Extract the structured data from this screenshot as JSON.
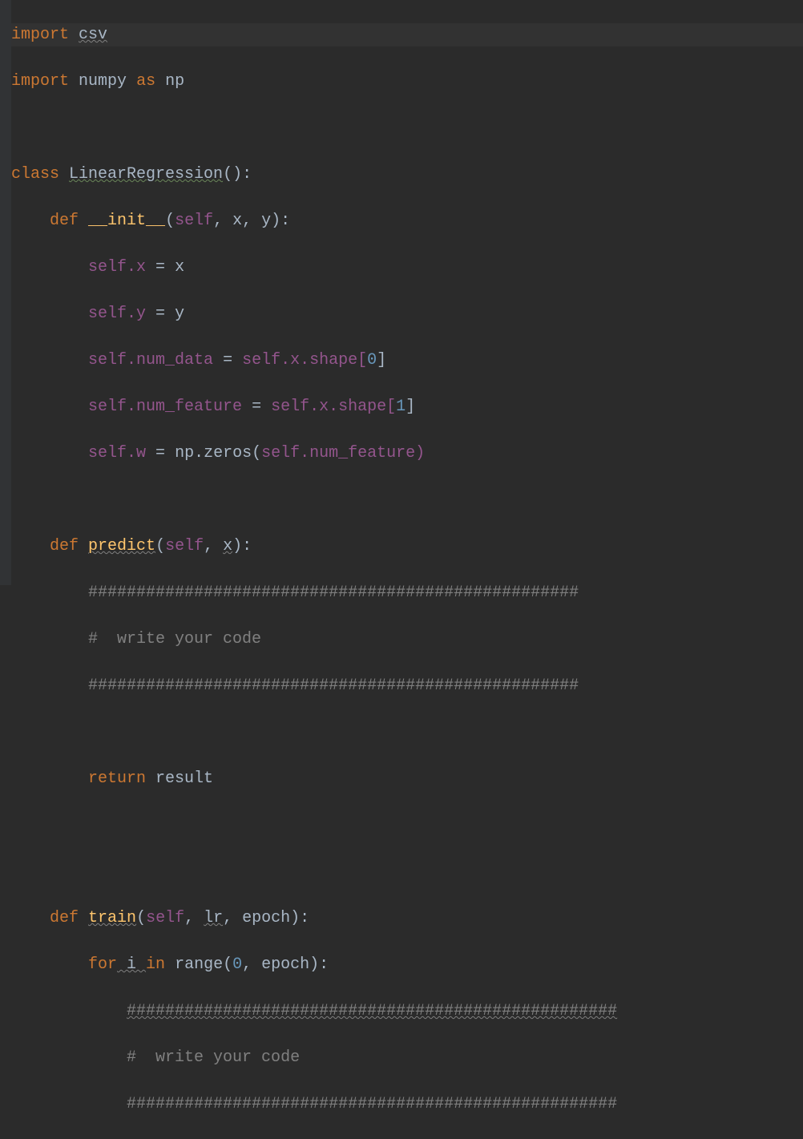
{
  "code": {
    "l1_import": "import",
    "l1_csv": "csv",
    "l2_import": "import",
    "l2_numpy": "numpy",
    "l2_as": "as",
    "l2_np": "np",
    "l4_class": "class",
    "l4_name": "LinearRegression",
    "l4_paren": "():",
    "l5_def": "def",
    "l5_init": "__init__",
    "l5_params_open": "(",
    "l5_self": "self",
    "l5_comma1": ", ",
    "l5_x": "x",
    "l5_comma2": ", ",
    "l5_y": "y",
    "l5_params_close": "):",
    "l6_self": "self",
    "l6_dotx": ".x ",
    "l6_eq": "= ",
    "l6_x": "x",
    "l7_self": "self",
    "l7_doty": ".y ",
    "l7_eq": "= ",
    "l7_y": "y",
    "l8_self": "self",
    "l8_dotnum": ".num_data ",
    "l8_eq": "= ",
    "l8_self2": "self",
    "l8_dotx": ".x.shape[",
    "l8_zero": "0",
    "l8_close": "]",
    "l9_self": "self",
    "l9_dotnum": ".num_feature ",
    "l9_eq": "= ",
    "l9_self2": "self",
    "l9_dotx": ".x.shape[",
    "l9_one": "1",
    "l9_close": "]",
    "l10_self": "self",
    "l10_dotw": ".w ",
    "l10_eq": "= ",
    "l10_np": "np.zeros(",
    "l10_self2": "self",
    "l10_dotnum": ".num_feature)",
    "l12_def": "def",
    "l12_predict": "predict",
    "l12_open": "(",
    "l12_self": "self",
    "l12_comma": ", ",
    "l12_x": "x",
    "l12_close": "):",
    "l13_hash": "###################################################",
    "l14_comment": "#  write your code",
    "l15_hash": "###################################################",
    "l17_return": "return",
    "l17_result": " result",
    "l20_def": "def",
    "l20_train": "train",
    "l20_open": "(",
    "l20_self": "self",
    "l20_comma1": ", ",
    "l20_lr": "lr",
    "l20_comma2": ", ",
    "l20_epoch": "epoch",
    "l20_close": "):",
    "l21_for": "for",
    "l21_i": " i ",
    "l21_in": "in",
    "l21_range": " range(",
    "l21_zero": "0",
    "l21_comma": ", ",
    "l21_epoch": "epoch):",
    "l22_hash": "###################################################",
    "l23_comment": "#  write your code",
    "l24_hash": "###################################################"
  }
}
